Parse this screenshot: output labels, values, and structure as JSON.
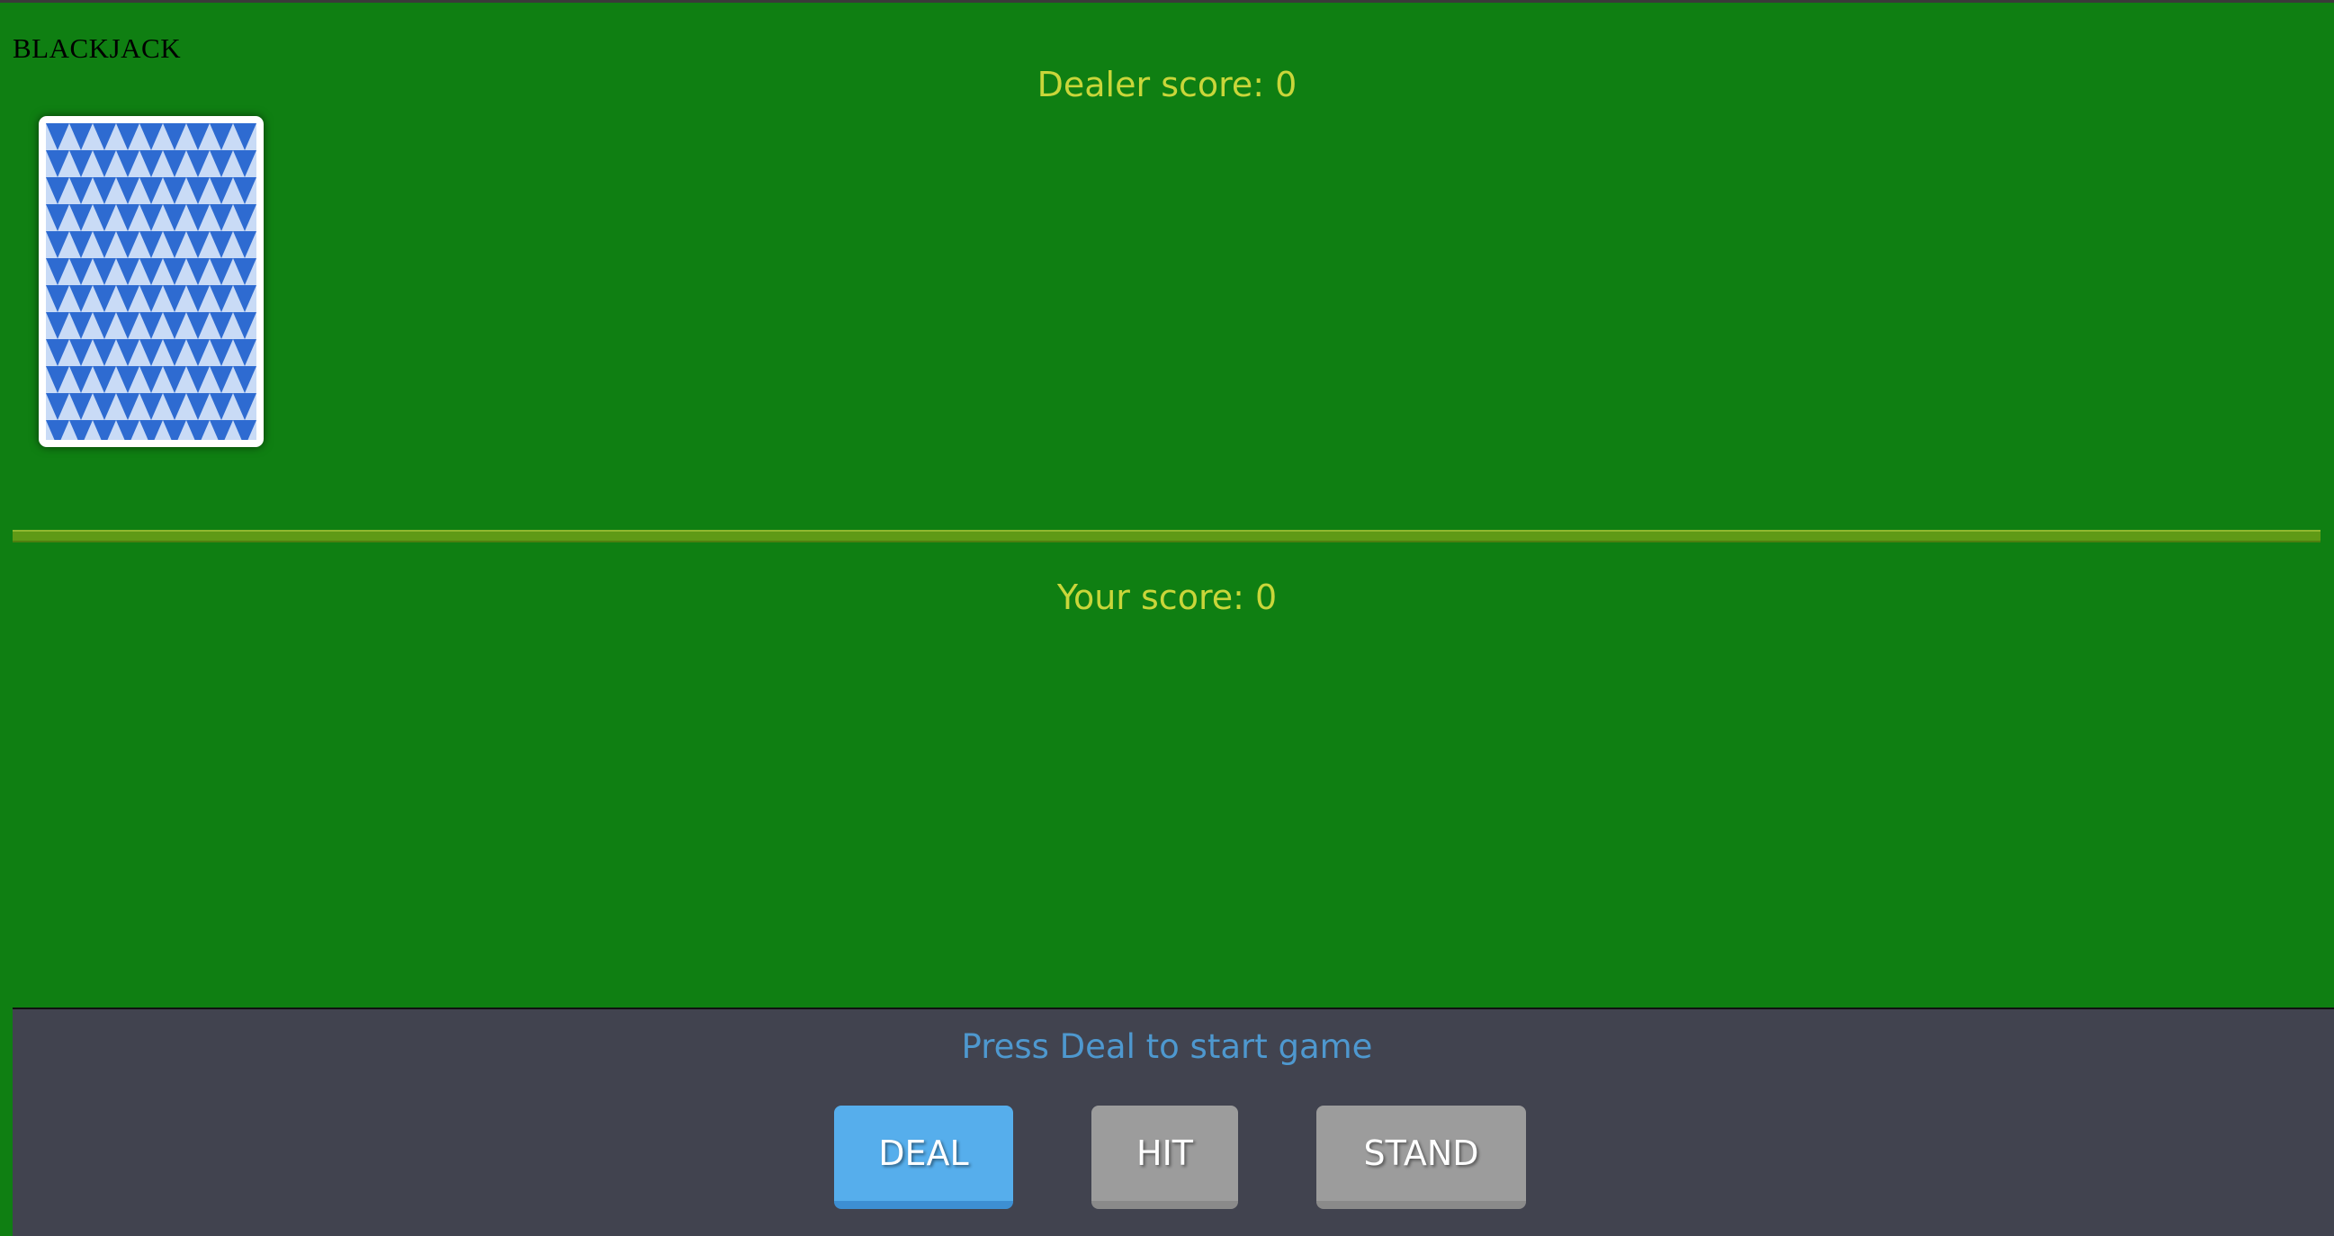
{
  "app": {
    "title": "BLACKJACK"
  },
  "dealer": {
    "score_label": "Dealer score: 0"
  },
  "player": {
    "score_label": "Your score: 0"
  },
  "deck": {
    "icon": "card-back-icon",
    "pattern_colors": [
      "#2e6bd1",
      "#c9dbf6"
    ]
  },
  "controls": {
    "status_text": "Press Deal to start game",
    "buttons": [
      {
        "label": "DEAL",
        "color": "#56aeec"
      },
      {
        "label": "HIT",
        "color": "#9c9c9c"
      },
      {
        "label": "STAND",
        "color": "#9c9c9c"
      }
    ]
  },
  "colors": {
    "felt": "#0f7f12",
    "score_text": "#c9d63a",
    "panel": "#41434f",
    "status_text": "#4e98cf"
  }
}
